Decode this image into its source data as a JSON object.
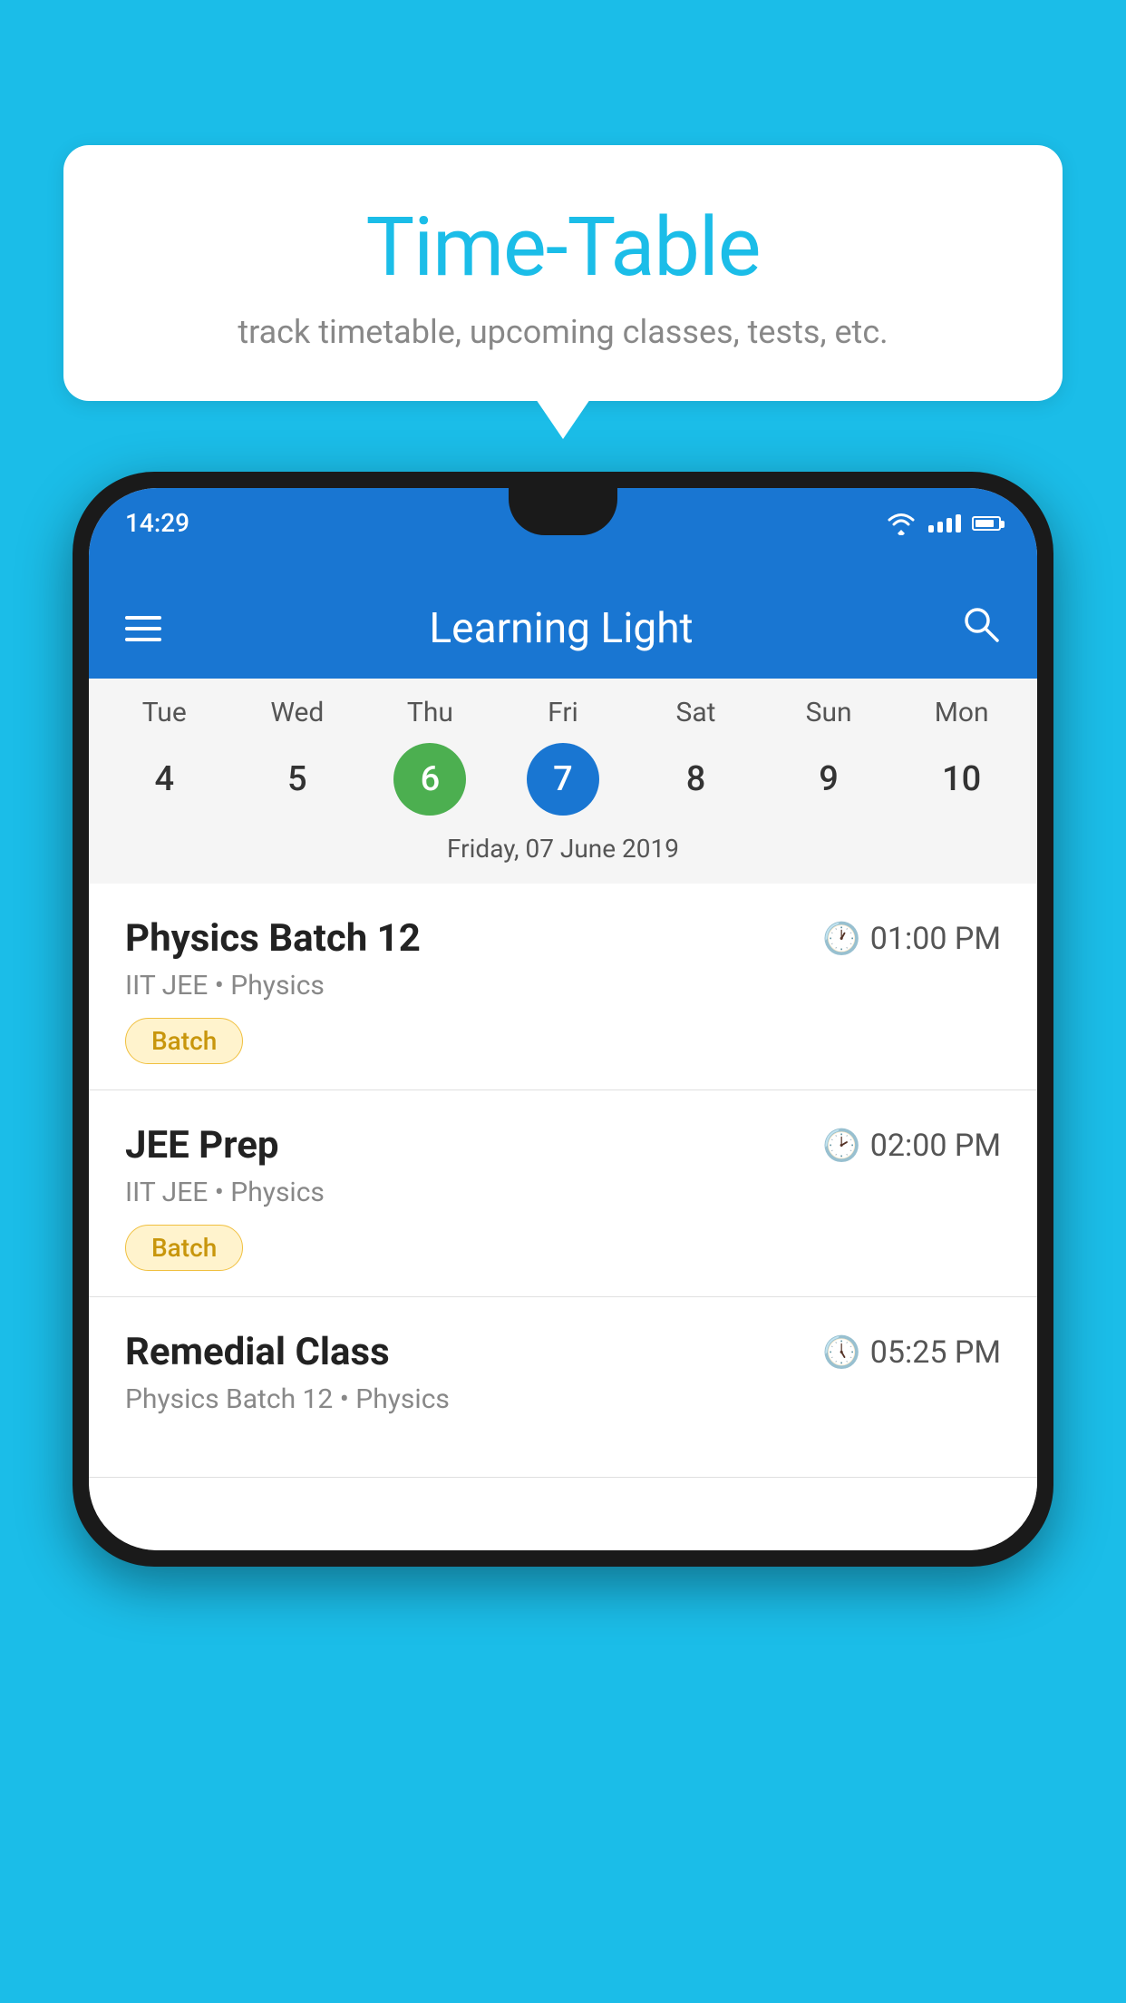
{
  "background": {
    "color": "#1BBDE8"
  },
  "speech_bubble": {
    "title": "Time-Table",
    "subtitle": "track timetable, upcoming classes, tests, etc."
  },
  "phone": {
    "status_bar": {
      "time": "14:29"
    },
    "toolbar": {
      "title": "Learning Light",
      "menu_icon": "menu-icon",
      "search_icon": "search-icon"
    },
    "calendar": {
      "days": [
        {
          "label": "Tue",
          "number": "4"
        },
        {
          "label": "Wed",
          "number": "5"
        },
        {
          "label": "Thu",
          "number": "6",
          "state": "today"
        },
        {
          "label": "Fri",
          "number": "7",
          "state": "selected"
        },
        {
          "label": "Sat",
          "number": "8"
        },
        {
          "label": "Sun",
          "number": "9"
        },
        {
          "label": "Mon",
          "number": "10"
        }
      ],
      "selected_date_label": "Friday, 07 June 2019"
    },
    "schedule": {
      "items": [
        {
          "title": "Physics Batch 12",
          "time": "01:00 PM",
          "subtitle": "IIT JEE • Physics",
          "tag": "Batch"
        },
        {
          "title": "JEE Prep",
          "time": "02:00 PM",
          "subtitle": "IIT JEE • Physics",
          "tag": "Batch"
        },
        {
          "title": "Remedial Class",
          "time": "05:25 PM",
          "subtitle": "Physics Batch 12 • Physics",
          "tag": null
        }
      ]
    }
  }
}
